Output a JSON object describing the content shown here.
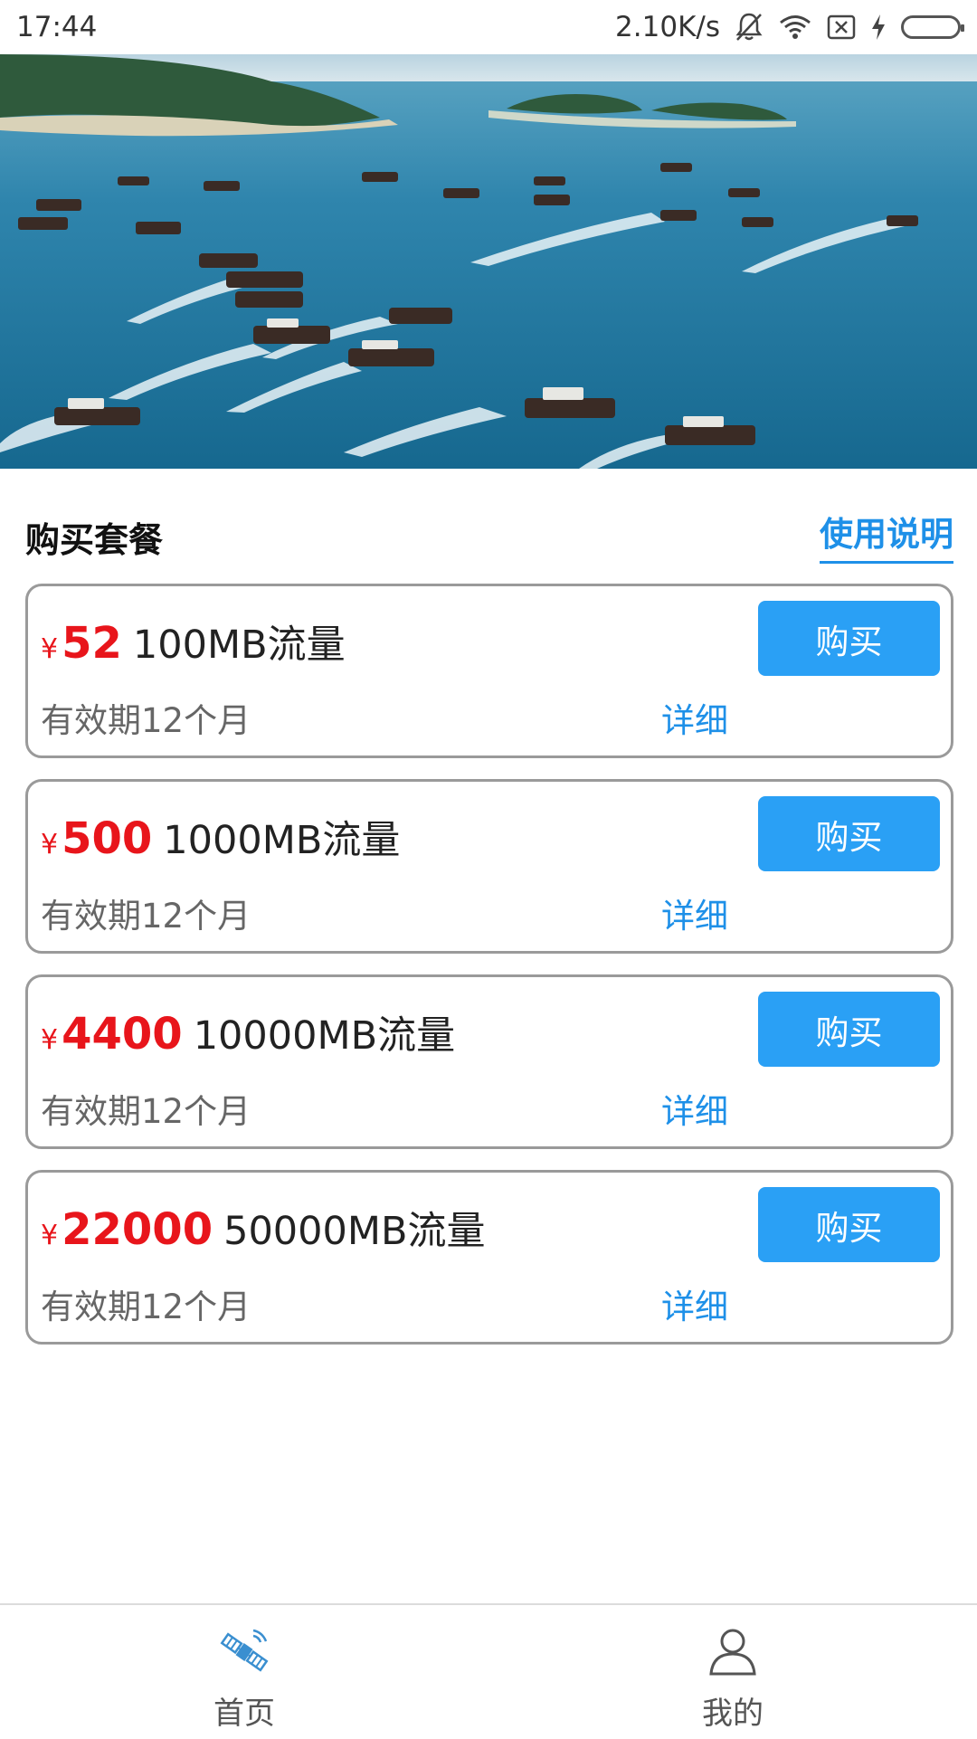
{
  "status_bar": {
    "time": "17:44",
    "network_speed": "2.10K/s",
    "icons": [
      "bell-off-icon",
      "wifi-icon",
      "sim-x-icon",
      "charging-icon",
      "battery-icon"
    ]
  },
  "banner": {
    "image": "fishing boats on sea"
  },
  "section": {
    "title": "购买套餐",
    "usage_link": "使用说明"
  },
  "plans": [
    {
      "currency": "¥",
      "price": "52",
      "name": "100MB流量",
      "validity": "有效期12个月",
      "detail": "详细",
      "buy": "购买"
    },
    {
      "currency": "¥",
      "price": "500",
      "name": "1000MB流量",
      "validity": "有效期12个月",
      "detail": "详细",
      "buy": "购买"
    },
    {
      "currency": "¥",
      "price": "4400",
      "name": "10000MB流量",
      "validity": "有效期12个月",
      "detail": "详细",
      "buy": "购买"
    },
    {
      "currency": "¥",
      "price": "22000",
      "name": "50000MB流量",
      "validity": "有效期12个月",
      "detail": "详细",
      "buy": "购买"
    }
  ],
  "bottom_nav": {
    "items": [
      {
        "label": "首页",
        "icon": "satellite-icon",
        "active": true
      },
      {
        "label": "我的",
        "icon": "user-icon",
        "active": false
      }
    ]
  },
  "colors": {
    "accent": "#2aa0f5",
    "link": "#1e90e8",
    "price": "#e8151b",
    "border": "#9a9a9a"
  }
}
